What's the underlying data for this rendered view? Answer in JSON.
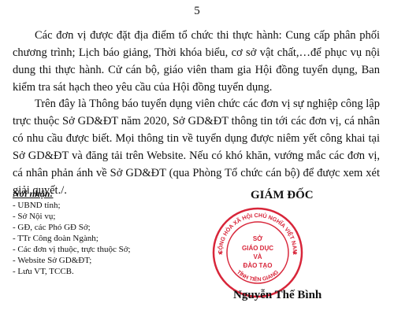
{
  "page_number": "5",
  "paragraphs": [
    "Các đơn vị được đặt địa điểm tổ chức thi thực hành: Cung cấp phân phối chương trình; Lịch báo giảng, Thời khóa biểu, cơ sở vật chất,…để phục vụ nội dung thi thực hành. Cử cán bộ, giáo viên tham gia Hội đồng tuyển dụng, Ban kiểm tra sát hạch theo yêu cầu của Hội đồng tuyển dụng.",
    "Trên đây là Thông báo tuyển dụng viên chức các đơn vị sự nghiệp công lập trực thuộc Sở GD&ĐT năm 2020, Sở GD&ĐT thông tin tới các đơn vị, cá nhân có nhu cầu được biết. Mọi thông tin về tuyển dụng được niêm yết công khai tại Sở GD&ĐT và đăng tải trên Website. Nếu có khó khăn, vướng mắc các đơn vị, cá nhân phản ánh về Sở GD&ĐT (qua Phòng Tổ chức cán bộ) để được xem xét giải quyết./."
  ],
  "recipients": {
    "title": "Nơi nhận:",
    "items": [
      "- UBND tỉnh;",
      "- Sở Nội vụ;",
      "- GĐ, các Phó GĐ Sở;",
      "- TTr Công đoàn Ngành;",
      "- Các đơn vị thuộc, trực thuộc Sở;",
      "- Website Sở GD&ĐT;",
      "- Lưu VT, TCCB."
    ]
  },
  "signature": {
    "title": "GIÁM ĐỐC",
    "name": "Nguyễn Thế Bình"
  },
  "seal": {
    "ring_text": "CỘNG HÒA XÃ HỘI CHỦ NGHĨA VIỆT NAM",
    "bottom_text": "TỈNH TIỀN GIANG",
    "center_lines": [
      "SỞ",
      "GIÁO DỤC",
      "VÀ",
      "ĐÀO TẠO"
    ],
    "color": "#d8263a"
  }
}
